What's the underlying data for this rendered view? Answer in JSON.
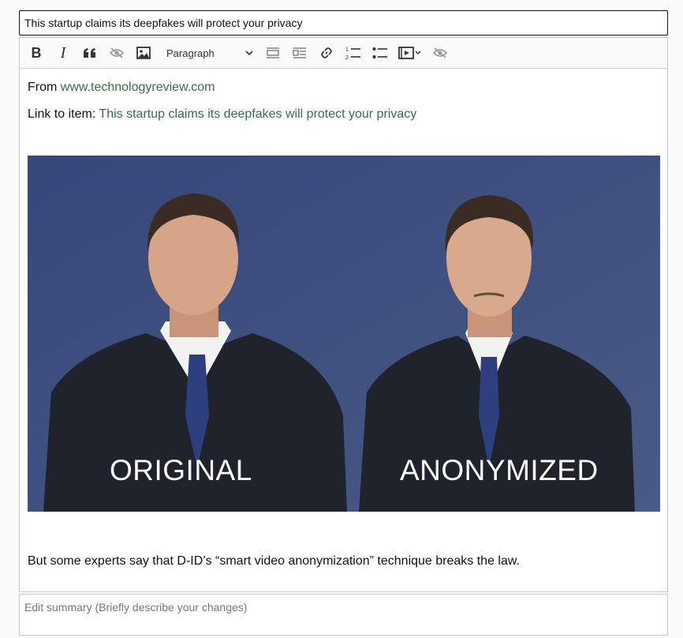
{
  "title_field": {
    "value": "This startup claims its deepfakes will protect your privacy"
  },
  "toolbar": {
    "bold_label": "B",
    "italic_label": "I",
    "heading_select": "Paragraph",
    "buttons": [
      "bold-icon",
      "italic-icon",
      "blockquote-icon",
      "hide-icon",
      "image-icon",
      "heading-select",
      "horizontal-rule-icon",
      "align-icon",
      "link-icon",
      "numbered-list-icon",
      "bulleted-list-icon",
      "media-embed-icon",
      "eye-off-icon"
    ]
  },
  "content": {
    "from_label": "From ",
    "from_link": "www.technologyreview.com",
    "link_label": "Link to item: ",
    "link_text": "This startup claims its deepfakes will protect your privacy",
    "image": {
      "caption_left": "ORIGINAL",
      "caption_right": "ANONYMIZED"
    },
    "body_text": "But some experts say that D-ID’s “smart video anonymization” technique breaks the law."
  },
  "summary": {
    "placeholder": "Edit summary (Briefly describe your changes)"
  },
  "colors": {
    "link": "#3a6b4c",
    "image_background": "#3c4f7a",
    "suit": "#1f232c",
    "tie": "#2e3f80",
    "skin": "#d6a587",
    "hair": "#3a2c22"
  }
}
